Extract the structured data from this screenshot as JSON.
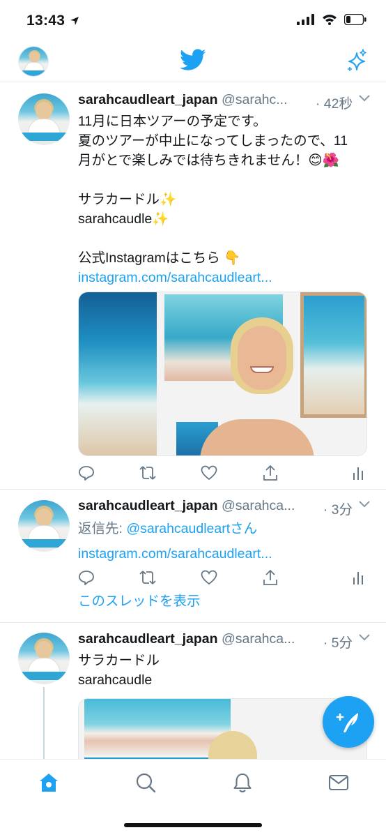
{
  "status_bar": {
    "time": "13:43"
  },
  "colors": {
    "accent": "#1da1f2",
    "secondary_text": "#657786",
    "divider": "#e6ecf0"
  },
  "tweets": [
    {
      "name": "sarahcaudleart_japan",
      "handle": "@sarahc...",
      "time": "· 42秒",
      "lines": [
        "11月に日本ツアーの予定です。",
        "夏のツアーが中止になってしまったので、11",
        "月がとで楽しみでは待ちきれません！😊🌺",
        "",
        "サラカードル✨",
        "sarahcaudle✨",
        "",
        "公式Instagramはこちら 👇"
      ],
      "link": "instagram.com/sarahcaudleart..."
    },
    {
      "name": "sarahcaudleart_japan",
      "handle": "@sarahca...",
      "time": "· 3分",
      "reply_prefix": "返信先: ",
      "reply_to": "@sarahcaudleart",
      "reply_suffix": "さん",
      "link": "instagram.com/sarahcaudleart...",
      "show_thread": "このスレッドを表示"
    },
    {
      "name": "sarahcaudleart_japan",
      "handle": "@sarahca...",
      "time": "· 5分",
      "lines": [
        "サラカードル",
        "sarahcaudle"
      ]
    }
  ],
  "icons": {
    "header": [
      "avatar",
      "twitter-bird-icon",
      "sparkle-icon"
    ],
    "tweet_actions": [
      "reply-icon",
      "retweet-icon",
      "like-icon",
      "share-icon",
      "analytics-icon"
    ],
    "tabs": [
      "home-icon",
      "search-icon",
      "notifications-icon",
      "messages-icon"
    ],
    "fab": "compose-tweet-icon"
  }
}
